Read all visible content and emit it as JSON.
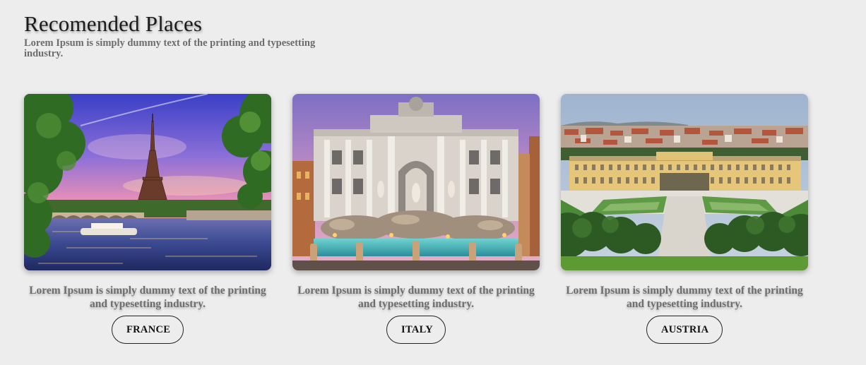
{
  "header": {
    "title": "Recomended Places",
    "subtitle": "Lorem Ipsum is simply dummy text of the printing and typesetting industry."
  },
  "places": [
    {
      "image": "eiffel-tower-paris-photo",
      "description": "Lorem Ipsum is simply dummy text of the printing and typesetting industry.",
      "button_label": "FRANCE"
    },
    {
      "image": "trevi-fountain-rome-photo",
      "description": "Lorem Ipsum is simply dummy text of the printing and typesetting industry.",
      "button_label": "ITALY"
    },
    {
      "image": "schonbrunn-palace-vienna-photo",
      "description": "Lorem Ipsum is simply dummy text of the printing and typesetting industry.",
      "button_label": "AUSTRIA"
    }
  ],
  "colors": {
    "background": "#ededed",
    "title": "#1b1b1b",
    "muted_text": "#6e6e6e",
    "button_border": "#222222"
  }
}
